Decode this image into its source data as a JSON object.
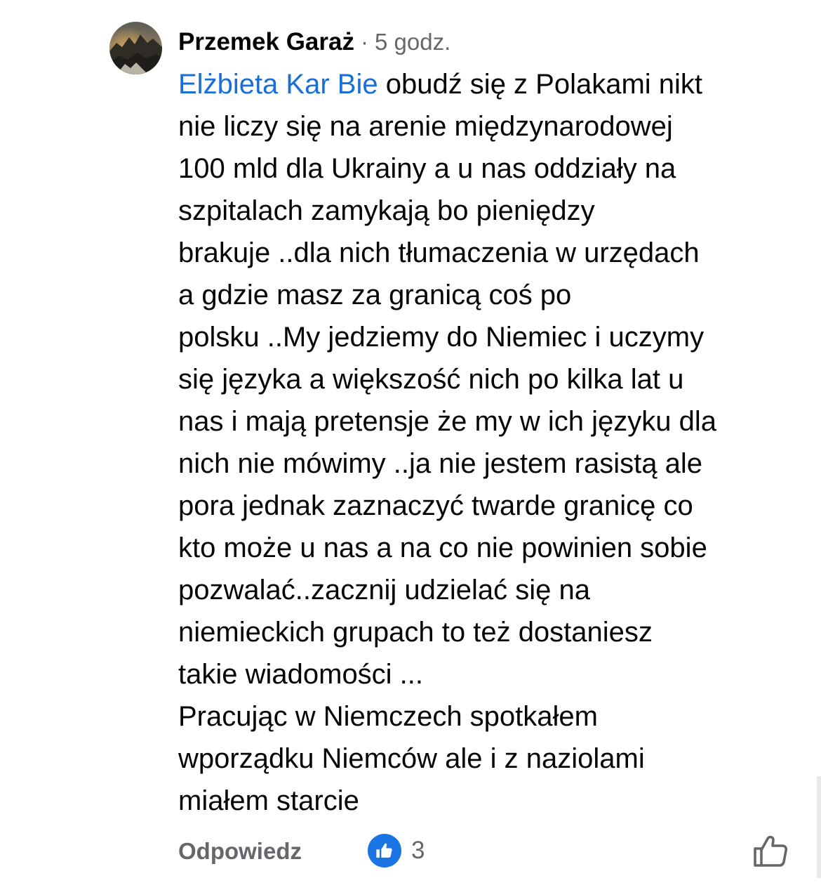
{
  "comment": {
    "author": "Przemek Garaż",
    "separator": "·",
    "time": "5 godz.",
    "mention": "Elżbieta Kar Bie",
    "first_line_rest": " obudź się z Polakami nikt",
    "lines": [
      "nie liczy się na arenie międzynarodowej",
      "100 mld dla Ukrainy a u nas oddziały na",
      "szpitalach zamykają bo pieniędzy",
      "brakuje ..dla nich tłumaczenia w urzędach",
      "a gdzie masz za granicą coś po",
      "polsku ..My jedziemy do Niemiec i uczymy",
      "się języka a większość nich po kilka lat u",
      "nas i mają pretensje że my w ich języku dla",
      "nich nie mówimy ..ja nie jestem rasistą ale",
      "pora jednak zaznaczyć twarde granicę co",
      "kto może u nas a na co nie powinien sobie",
      "pozwalać..zacznij udzielać się na",
      "niemieckich grupach to też dostaniesz",
      "takie wiadomości ...",
      "Pracując w Niemczech spotkałem",
      "wporządku Niemców ale i z naziolami",
      "miałem starcie"
    ]
  },
  "actions": {
    "reply_label": "Odpowiedz",
    "reaction_count": "3",
    "reaction_icon": "like-reaction-icon",
    "like_icon": "thumbs-up-outline-icon"
  },
  "colors": {
    "mention": "#1a6ed8",
    "secondary_text": "#65676b",
    "like_blue": "#1b74e4"
  }
}
